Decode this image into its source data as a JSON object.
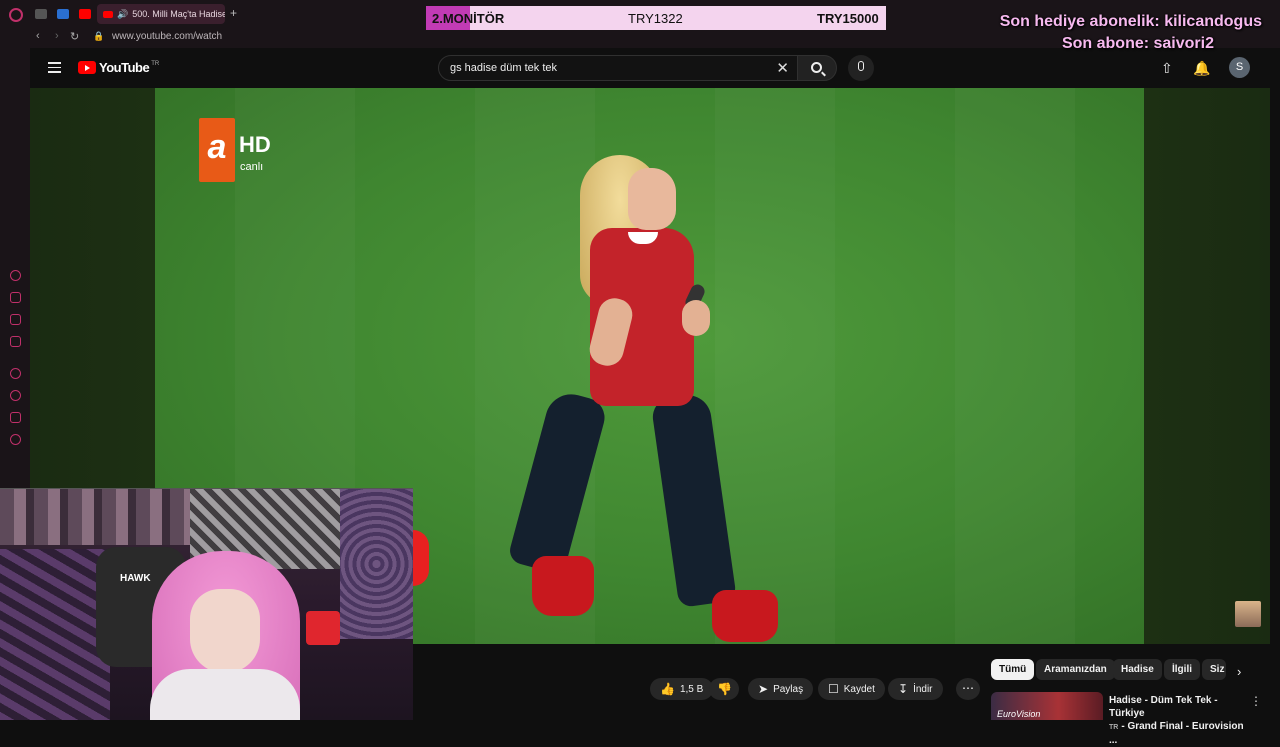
{
  "browser": {
    "tab_title": "500. Milli Maç'ta Hadise",
    "url": "www.youtube.com/watch",
    "new_tab": "+"
  },
  "overlay": {
    "monitor_label": "2.MONİTÖR",
    "price_1": "TRY1322",
    "price_2": "TRY15000",
    "last_gift_sub": "Son hediye abonelik: kilicandogus",
    "last_sub": "Son abone: saivori2"
  },
  "youtube": {
    "logo_text": "YouTube",
    "region": "TR",
    "search_query": "gs hadise düm tek tek",
    "avatar_letter": "S"
  },
  "video": {
    "channel_logo_letter": "a",
    "channel_logo_hd": "HD",
    "channel_logo_live": "canlı"
  },
  "actions": {
    "likes": "1,5 B",
    "share": "Paylaş",
    "save": "Kaydet",
    "download": "İndir"
  },
  "chips": [
    "Tümü",
    "Aramanızdan",
    "Hadise",
    "İlgili",
    "Siz"
  ],
  "recommendation": {
    "title_line1": "Hadise - Düm Tek Tek - Türkiye",
    "region": "TR",
    "title_line2": "- Grand Final - Eurovision ...",
    "thumb_text": "EuroVision"
  },
  "webcam": {
    "hoodie_text": "HAWK"
  },
  "colors": {
    "accent_pink": "#f7b9ef",
    "monitor_bg": "#f4d4ee",
    "youtube_red": "#ff0000"
  },
  "icons": [
    "opera-icon",
    "hamburger-icon",
    "search-icon",
    "clear-icon",
    "mic-icon",
    "upload-icon",
    "bell-icon",
    "like-icon",
    "dislike-icon",
    "share-icon",
    "save-icon",
    "download-icon",
    "more-icon",
    "chevron-right-icon"
  ]
}
